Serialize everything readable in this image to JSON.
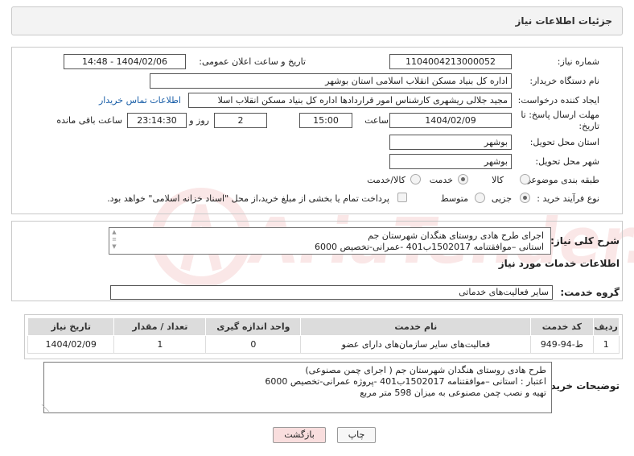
{
  "header": {
    "title": "جزئیات اطلاعات نیاز"
  },
  "fields": {
    "need_number_label": "شماره نیاز:",
    "need_number": "1104004213000052",
    "announce_label": "تاریخ و ساعت اعلان عمومی:",
    "announce_value": "1404/02/06 - 14:48",
    "buyer_org_label": "نام دستگاه خریدار:",
    "buyer_org": "اداره کل بنیاد مسکن انقلاب اسلامی استان بوشهر",
    "requester_label": "ایجاد کننده درخواست:",
    "requester": "مجید جلالی ریشهری کارشناس امور قراردادها اداره کل بنیاد مسکن انقلاب اسلا",
    "contact_link": "اطلاعات تماس خریدار",
    "deadline_label_1": "مهلت ارسال پاسخ: تا",
    "deadline_label_2": "تاریخ:",
    "deadline_date": "1404/02/09",
    "time_label": "ساعت",
    "deadline_time": "15:00",
    "days_value": "2",
    "days_label": "روز و",
    "remaining_time": "23:14:30",
    "remaining_label": "ساعت باقی مانده",
    "province_label": "استان محل تحویل:",
    "province": "بوشهر",
    "city_label": "شهر محل تحویل:",
    "city": "بوشهر",
    "category_label": "طبقه بندی موضوعی:",
    "category_options": [
      "کالا",
      "خدمت",
      "کالا/خدمت"
    ],
    "category_selected": "خدمت",
    "process_label": "نوع فرآیند خرید :",
    "process_options": [
      "جزیی",
      "متوسط"
    ],
    "process_selected": "جزیی",
    "treasury_note": "پرداخت تمام یا بخشی از مبلغ خرید،از محل \"اسناد خزانه اسلامی\" خواهد بود."
  },
  "summary": {
    "label": "شرح کلی نیاز:",
    "line1": "اجرای طرح هادی روستای هنگدان شهرستان جم",
    "line2": "استانی –موافقتنامه 1502017ب401 -عمرانی-تخصیص 6000"
  },
  "services": {
    "section_title": "اطلاعات خدمات مورد نیاز",
    "group_label": "گروه خدمت:",
    "group_value": "سایر فعالیت‌های خدماتی",
    "columns": [
      "ردیف",
      "کد خدمت",
      "نام خدمت",
      "واحد اندازه گیری",
      "تعداد / مقدار",
      "تاریخ نیاز"
    ],
    "rows": [
      {
        "row": "1",
        "code": "ط-94-949",
        "name": "فعالیت‌های سایر سازمان‌های دارای عضو",
        "unit": "0",
        "qty": "1",
        "date": "1404/02/09"
      }
    ]
  },
  "buyer_notes": {
    "label": "توضیحات خریدار:",
    "line1": "طرح هادی روستای هنگدان شهرستان جم ( اجرای چمن مصنوعی)",
    "line2": "اعتبار : استانی –موافقتنامه 1502017ب401 -پروژه عمرانی-تخصیص 6000",
    "line3": "تهیه و نصب چمن مصنوعی به میزان 598 متر مربع"
  },
  "buttons": {
    "print": "چاپ",
    "back": "بازگشت"
  },
  "watermark": {
    "text": "AriaTender.neT"
  },
  "colors": {
    "back_button_bg": "#f9dede",
    "link": "#1a5fa8",
    "table_header": "#dcdcdc"
  }
}
